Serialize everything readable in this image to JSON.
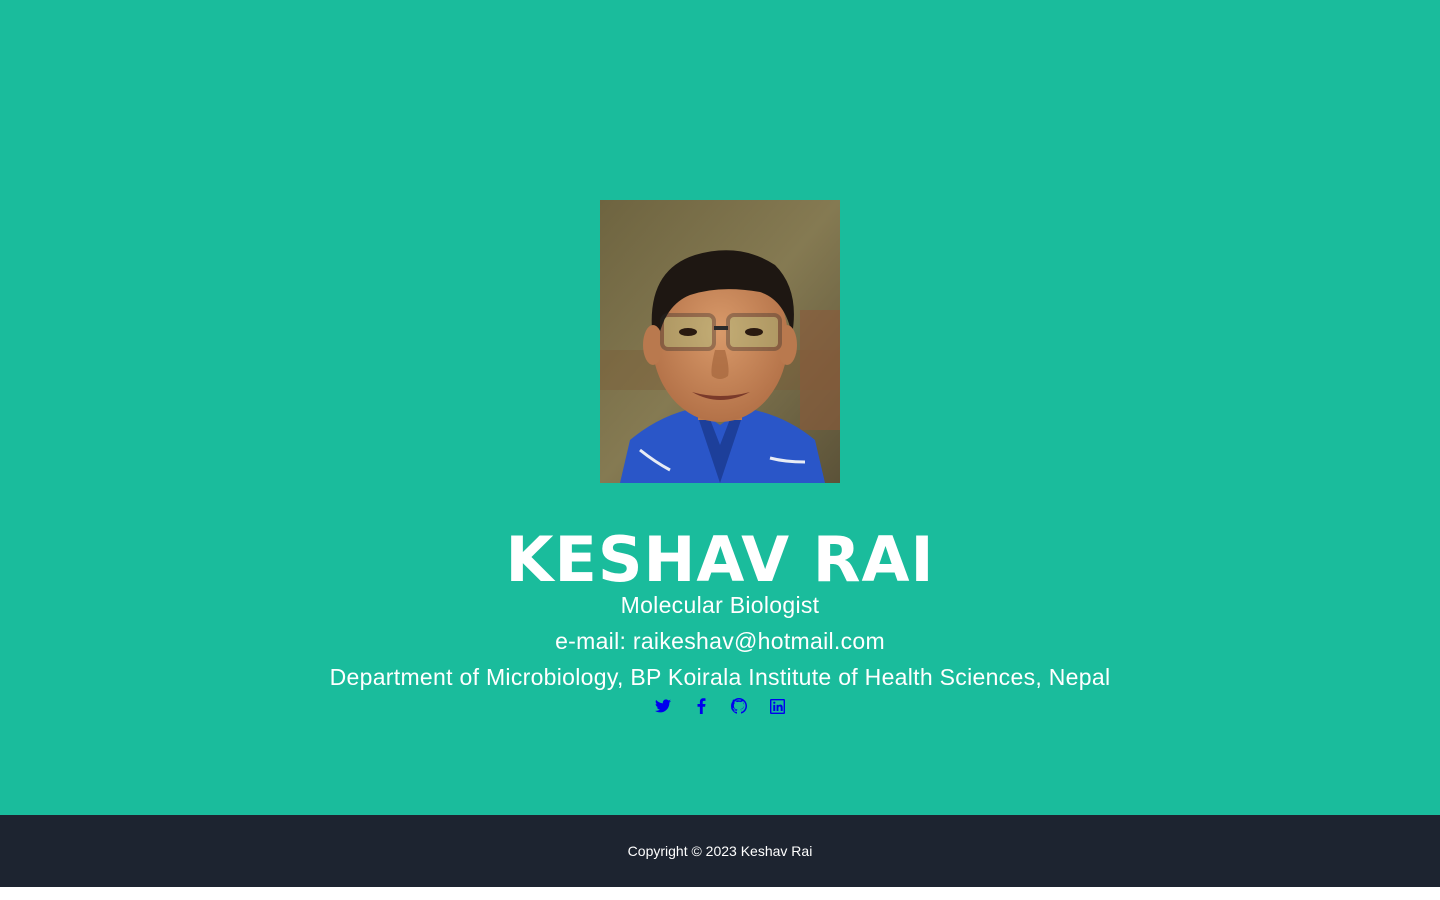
{
  "profile": {
    "name": "KESHAV RAI",
    "role": "Molecular Biologist",
    "email_line": "e-mail: raikeshav@hotmail.com",
    "affiliation": "Department of Microbiology, BP Koirala Institute of Health Sciences, Nepal",
    "photo_alt": "Keshav Rai"
  },
  "social": [
    {
      "icon": "twitter-icon",
      "label": "Twitter"
    },
    {
      "icon": "facebook-icon",
      "label": "Facebook"
    },
    {
      "icon": "github-icon",
      "label": "GitHub"
    },
    {
      "icon": "linkedin-icon",
      "label": "LinkedIn"
    }
  ],
  "footer": {
    "copyright": "Copyright © 2023 Keshav Rai"
  },
  "colors": {
    "hero_bg": "#1abc9c",
    "footer_bg": "#1d2430",
    "text": "#ffffff",
    "link": "#0000ee"
  }
}
